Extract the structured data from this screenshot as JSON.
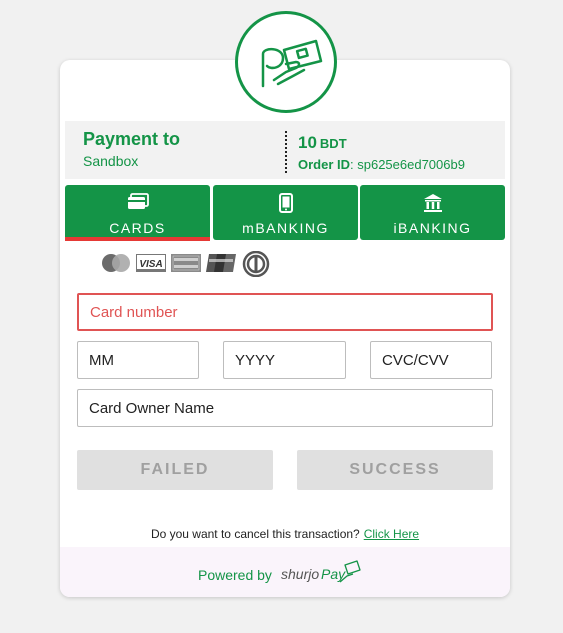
{
  "header": {
    "logo_icon": "shurjopay-hand-logo-icon",
    "payment_to_label": "Payment to",
    "merchant_name": "Sandbox",
    "amount": "10",
    "currency": "BDT",
    "order_label": "Order ID",
    "order_id": ": sp625e6ed7006b9"
  },
  "tabs": [
    {
      "label": "CARDS",
      "icon": "credit-card-icon",
      "active": true
    },
    {
      "label": "mBANKING",
      "icon": "mobile-phone-icon",
      "active": false
    },
    {
      "label": "iBANKING",
      "icon": "bank-icon",
      "active": false
    }
  ],
  "card_brands": [
    "mastercard-icon",
    "visa-icon",
    "american-express-icon",
    "unionpay-icon",
    "diners-club-icon"
  ],
  "form": {
    "card_number_placeholder": "Card number",
    "month_placeholder": "MM",
    "year_placeholder": "YYYY",
    "cvc_placeholder": "CVC/CVV",
    "owner_placeholder": "Card Owner Name"
  },
  "buttons": {
    "failed_label": "FAILED",
    "success_label": "SUCCESS"
  },
  "cancel": {
    "question": "Do you want to cancel this transaction?",
    "link_label": "Click Here"
  },
  "footer": {
    "powered_by": "Powered by",
    "brand_logo": "shurjopay-logo-icon"
  },
  "colors": {
    "accent": "#149447",
    "active_tab_underline": "#e53935",
    "invalid_border": "#e05454",
    "button_disabled": "#e0e0e0",
    "footer_bg": "#faf4fb"
  }
}
